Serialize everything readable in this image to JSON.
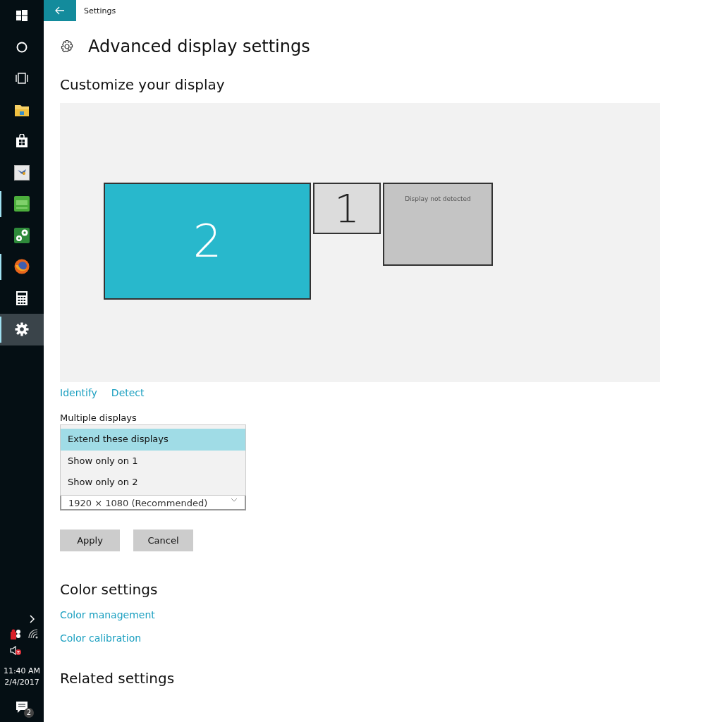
{
  "window": {
    "title": "Settings"
  },
  "taskbar": {
    "apps": [
      {
        "kind": "start",
        "running": false,
        "selected": false
      },
      {
        "kind": "search",
        "running": false,
        "selected": false
      },
      {
        "kind": "task-view",
        "running": false,
        "selected": false
      },
      {
        "kind": "explorer",
        "running": false,
        "selected": false
      },
      {
        "kind": "store",
        "running": false,
        "selected": false
      },
      {
        "kind": "picture-app",
        "running": false,
        "selected": false
      },
      {
        "kind": "fh-app",
        "running": true,
        "selected": false
      },
      {
        "kind": "gears-app",
        "running": false,
        "selected": false
      },
      {
        "kind": "firefox",
        "running": true,
        "selected": false
      },
      {
        "kind": "calculator",
        "running": false,
        "selected": false
      },
      {
        "kind": "settings",
        "running": true,
        "selected": true
      }
    ],
    "tray": {
      "time": "11:40 AM",
      "date": "2/4/2017",
      "notifications": "2",
      "muted": true
    }
  },
  "page": {
    "title": "Advanced display settings",
    "customize": {
      "heading": "Customize your display",
      "displays": [
        {
          "kind": "display",
          "label": "2",
          "selected": true
        },
        {
          "kind": "display",
          "label": "1",
          "selected": false
        },
        {
          "kind": "undetected",
          "label": "Display not detected",
          "selected": false
        }
      ],
      "links": [
        "Identify",
        "Detect"
      ]
    },
    "multiple_displays": {
      "label": "Multiple displays",
      "options": [
        {
          "label": "Extend these displays",
          "selected": true
        },
        {
          "label": "Show only on 1",
          "selected": false
        },
        {
          "label": "Show only on 2",
          "selected": false
        }
      ],
      "expanded": true
    },
    "resolution": {
      "value": "1920 × 1080 (Recommended)"
    },
    "buttons": [
      "Apply",
      "Cancel"
    ],
    "color_settings": {
      "heading": "Color settings",
      "links": [
        "Color management",
        "Color calibration"
      ]
    },
    "related_settings": {
      "heading": "Related settings"
    }
  }
}
